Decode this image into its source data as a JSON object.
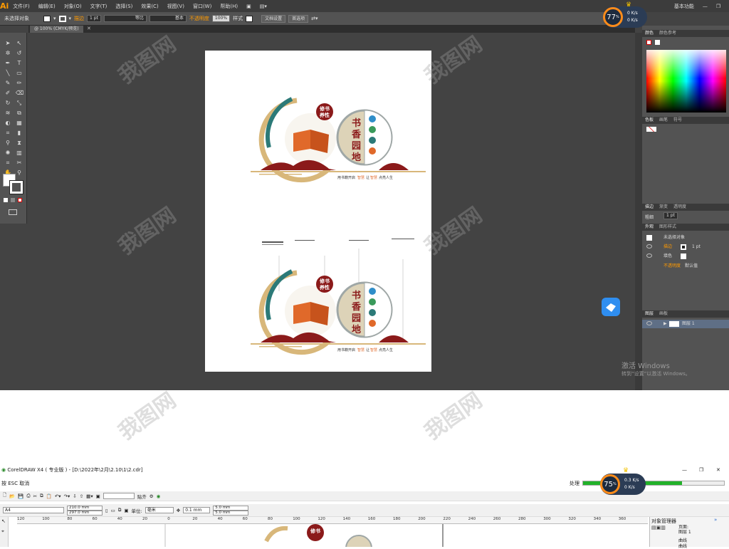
{
  "illustrator": {
    "logo": "Ai",
    "menu": [
      "文件(F)",
      "编辑(E)",
      "对象(O)",
      "文字(T)",
      "选择(S)",
      "效果(C)",
      "视图(V)",
      "窗口(W)",
      "帮助(H)"
    ],
    "workspace": "基本功能",
    "control": {
      "selection": "未选择对象",
      "stroke_label": "描边",
      "stroke_width": "1 pt",
      "profile1": "等比",
      "profile2": "基本",
      "opacity_label": "不透明度",
      "opacity_value": "100%",
      "style_label": "样式",
      "doc_setup": "文档设置",
      "preferences": "首选项"
    },
    "doc_tab": "@ 100% (CMYK/预览)",
    "panels": {
      "color_tabs": [
        "颜色",
        "颜色参考"
      ],
      "swatch_tabs": [
        "色板",
        "画笔",
        "符号"
      ],
      "stroke_tabs": [
        "描边",
        "渐变",
        "透明度"
      ],
      "weight_label": "粗细",
      "weight_value": "1 pt",
      "appearance_tabs": [
        "外观",
        "图形样式"
      ],
      "appearance_title": "未选择对象",
      "appearance_stroke": "描边",
      "appearance_stroke_val": "1 pt",
      "appearance_fill": "填色",
      "appearance_opacity": "不透明度",
      "appearance_opacity_val": "默认值",
      "layers_tabs": [
        "图层",
        "画板"
      ],
      "layer_name": "图层 1"
    },
    "artwork": {
      "badge_text": "修书养性",
      "badge_line1": "修书",
      "badge_line2": "养性",
      "title_line1": "书",
      "title_line2": "香",
      "title_line3": "园",
      "title_line4": "地",
      "slogan_a": "用书籍开启",
      "slogan_b": "智慧",
      "slogan_c": "让",
      "slogan_d": "智慧",
      "slogan_e": "点亮人生"
    },
    "windows_watermark": {
      "line1": "激活 Windows",
      "line2": "转到“设置”以激活 Windows。"
    }
  },
  "perf_widget_top": {
    "percent": "77",
    "unit": "%",
    "up": "0 K/s",
    "down": "0 K/s"
  },
  "coreldraw": {
    "title": "CorelDRAW X4 ( 专业版 ) - [D:\\2022年\\2月\\2.10\\1\\2.cdr]",
    "hint": "按 ESC 取消",
    "processing": "处理",
    "progress": 0.7,
    "paste_label": "贴齐",
    "paper": "A4",
    "width": "210.0 mm",
    "height": "297.0 mm",
    "unit_label": "单位:",
    "unit_value": "毫米",
    "nudge": "0.1 mm",
    "dup_x": "5.0 mm",
    "dup_y": "5.0 mm",
    "ruler": [
      "120",
      "100",
      "80",
      "60",
      "40",
      "20",
      "0",
      "20",
      "40",
      "60",
      "80",
      "100",
      "120",
      "140",
      "160",
      "180",
      "200",
      "220",
      "240",
      "260",
      "280",
      "300",
      "320",
      "340",
      "360"
    ],
    "obj_manager": "对象管理器",
    "obj_page": "页面:",
    "obj_layer": "图层 1",
    "obj_curve1": "曲线",
    "obj_curve2": "曲线"
  },
  "perf_widget_bottom": {
    "percent": "75",
    "unit": "%",
    "up": "0.3 K/s",
    "down": "0 K/s"
  },
  "colors": {
    "maroon": "#8b1a1a",
    "orange": "#e0692a",
    "teal": "#2c7a78",
    "gold": "#d8b77a",
    "ai_orange": "#ff9a00",
    "progress_green": "#22b22a"
  }
}
